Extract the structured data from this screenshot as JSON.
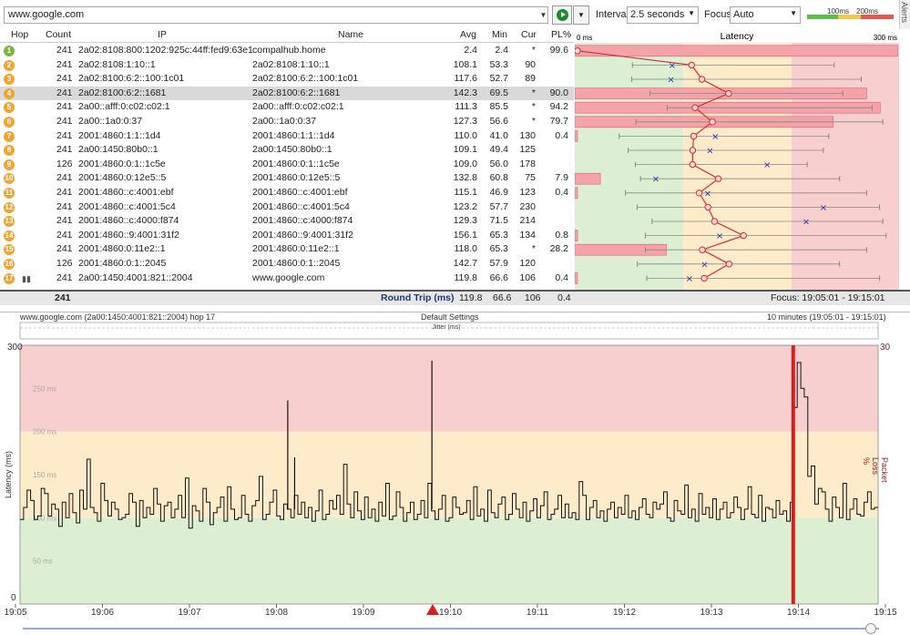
{
  "toolbar": {
    "url": "www.google.com",
    "interval_label": "Interval",
    "interval_value": "2.5 seconds",
    "focus_label": "Focus",
    "focus_value": "Auto",
    "legend_100": "100ms",
    "legend_200": "200ms"
  },
  "alerts_label": "Alerts",
  "table": {
    "headers": {
      "hop": "Hop",
      "count": "Count",
      "ip": "IP",
      "name": "Name",
      "avg": "Avg",
      "min": "Min",
      "cur": "Cur",
      "pl": "PL%",
      "latency": "Latency",
      "lat_min": "0 ms",
      "lat_max": "300 ms"
    },
    "rows": [
      {
        "hop": "1",
        "count": "241",
        "ip": "2a02:8108:800:1202:925c:44ff:fed9:63e1",
        "name": "compalhub.home",
        "avg": "2.4",
        "min": "2.4",
        "cur": "*",
        "pl": "99.6",
        "hopcolor": "#7cb342",
        "avgv": 2.4,
        "minv": 2.4,
        "curv": null,
        "maxv": null,
        "plv": 99.6
      },
      {
        "hop": "2",
        "count": "241",
        "ip": "2a02:8108:1:10::1",
        "name": "2a02:8108:1:10::1",
        "avg": "108.1",
        "min": "53.3",
        "cur": "90",
        "pl": "",
        "hopcolor": "#f0a530",
        "avgv": 108.1,
        "minv": 53.3,
        "curv": 90,
        "maxv": 240,
        "plv": 0
      },
      {
        "hop": "3",
        "count": "241",
        "ip": "2a02:8100:6:2::100:1c01",
        "name": "2a02:8100:6:2::100:1c01",
        "avg": "117.6",
        "min": "52.7",
        "cur": "89",
        "pl": "",
        "hopcolor": "#f0a530",
        "avgv": 117.6,
        "minv": 52.7,
        "curv": 89,
        "maxv": 265,
        "plv": 0
      },
      {
        "hop": "4",
        "count": "241",
        "ip": "2a02:8100:6:2::1681",
        "name": "2a02:8100:6:2::1681",
        "avg": "142.3",
        "min": "69.5",
        "cur": "*",
        "pl": "90.0",
        "hopcolor": "#f0a530",
        "avgv": 142.3,
        "minv": 69.5,
        "curv": null,
        "maxv": 248,
        "plv": 90.0
      },
      {
        "hop": "5",
        "count": "241",
        "ip": "2a00::afff:0:c02:c02:1",
        "name": "2a00::afff:0:c02:c02:1",
        "avg": "111.3",
        "min": "85.5",
        "cur": "*",
        "pl": "94.2",
        "hopcolor": "#f0a530",
        "avgv": 111.3,
        "minv": 85.5,
        "curv": null,
        "maxv": 275,
        "plv": 94.2
      },
      {
        "hop": "6",
        "count": "241",
        "ip": "2a00::1a0:0:37",
        "name": "2a00::1a0:0:37",
        "avg": "127.3",
        "min": "56.6",
        "cur": "*",
        "pl": "79.7",
        "hopcolor": "#f0a530",
        "avgv": 127.3,
        "minv": 56.6,
        "curv": null,
        "maxv": 285,
        "plv": 79.7
      },
      {
        "hop": "7",
        "count": "241",
        "ip": "2001:4860:1:1::1d4",
        "name": "2001:4860:1:1::1d4",
        "avg": "110.0",
        "min": "41.0",
        "cur": "130",
        "pl": "0.4",
        "hopcolor": "#f0a530",
        "avgv": 110.0,
        "minv": 41.0,
        "curv": 130,
        "maxv": 235,
        "plv": 0.4
      },
      {
        "hop": "8",
        "count": "241",
        "ip": "2a00:1450:80b0::1",
        "name": "2a00:1450:80b0::1",
        "avg": "109.1",
        "min": "49.4",
        "cur": "125",
        "pl": "",
        "hopcolor": "#f0a530",
        "avgv": 109.1,
        "minv": 49.4,
        "curv": 125,
        "maxv": 230,
        "plv": 0
      },
      {
        "hop": "9",
        "count": "126",
        "ip": "2001:4860:0:1::1c5e",
        "name": "2001:4860:0:1::1c5e",
        "avg": "109.0",
        "min": "56.0",
        "cur": "178",
        "pl": "",
        "hopcolor": "#f0a530",
        "avgv": 109.0,
        "minv": 56.0,
        "curv": 178,
        "maxv": 215,
        "plv": 0
      },
      {
        "hop": "10",
        "count": "241",
        "ip": "2001:4860:0:12e5::5",
        "name": "2001:4860:0:12e5::5",
        "avg": "132.8",
        "min": "60.8",
        "cur": "75",
        "pl": "7.9",
        "hopcolor": "#f0a530",
        "avgv": 132.8,
        "minv": 60.8,
        "curv": 75,
        "maxv": 245,
        "plv": 7.9
      },
      {
        "hop": "11",
        "count": "241",
        "ip": "2001:4860::c:4001:ebf",
        "name": "2001:4860::c:4001:ebf",
        "avg": "115.1",
        "min": "46.9",
        "cur": "123",
        "pl": "0.4",
        "hopcolor": "#f0a530",
        "avgv": 115.1,
        "minv": 46.9,
        "curv": 123,
        "maxv": 270,
        "plv": 0.4
      },
      {
        "hop": "12",
        "count": "241",
        "ip": "2001:4860::c:4001:5c4",
        "name": "2001:4860::c:4001:5c4",
        "avg": "123.2",
        "min": "57.7",
        "cur": "230",
        "pl": "",
        "hopcolor": "#f0a530",
        "avgv": 123.2,
        "minv": 57.7,
        "curv": 230,
        "maxv": 282,
        "plv": 0
      },
      {
        "hop": "13",
        "count": "241",
        "ip": "2001:4860::c:4000:f874",
        "name": "2001:4860::c:4000:f874",
        "avg": "129.3",
        "min": "71.5",
        "cur": "214",
        "pl": "",
        "hopcolor": "#f0a530",
        "avgv": 129.3,
        "minv": 71.5,
        "curv": 214,
        "maxv": 285,
        "plv": 0
      },
      {
        "hop": "14",
        "count": "241",
        "ip": "2001:4860::9:4001:31f2",
        "name": "2001:4860::9:4001:31f2",
        "avg": "156.1",
        "min": "65.3",
        "cur": "134",
        "pl": "0.8",
        "hopcolor": "#f0a530",
        "avgv": 156.1,
        "minv": 65.3,
        "curv": 134,
        "maxv": 288,
        "plv": 0.8
      },
      {
        "hop": "15",
        "count": "241",
        "ip": "2001:4860:0:11e2::1",
        "name": "2001:4860:0:11e2::1",
        "avg": "118.0",
        "min": "65.3",
        "cur": "*",
        "pl": "28.2",
        "hopcolor": "#f0a530",
        "avgv": 118.0,
        "minv": 65.3,
        "curv": null,
        "maxv": 270,
        "plv": 28.2
      },
      {
        "hop": "16",
        "count": "126",
        "ip": "2001:4860:0:1::2045",
        "name": "2001:4860:0:1::2045",
        "avg": "142.7",
        "min": "57.9",
        "cur": "120",
        "pl": "",
        "hopcolor": "#f0a530",
        "avgv": 142.7,
        "minv": 57.9,
        "curv": 120,
        "maxv": 245,
        "plv": 0
      },
      {
        "hop": "17",
        "count": "241",
        "ip": "2a00:1450:4001:821::2004",
        "name": "www.google.com",
        "avg": "119.8",
        "min": "66.6",
        "cur": "106",
        "pl": "0.4",
        "hopcolor": "#f0a530",
        "avgv": 119.8,
        "minv": 66.6,
        "curv": 106,
        "maxv": 282,
        "plv": 0.4
      }
    ],
    "footer": {
      "count": "241",
      "label": "Round Trip (ms)",
      "avg": "119.8",
      "min": "66.6",
      "cur": "106",
      "pl": "0.4",
      "focus": "Focus: 19:05:01 - 19:15:01"
    }
  },
  "graph": {
    "title_left": "www.google.com (2a00:1450:4001:821::2004) hop 17",
    "title_center": "Default Settings",
    "title_right": "10 minutes (19:05:01 - 19:15:01)",
    "jitter_label": "Jitter (ms)",
    "ylabel": "Latency (ms)",
    "y2label": "Packet Loss %",
    "y_top": "300",
    "y_bottom": "0",
    "y2_top": "30",
    "grid_labels": [
      "250 ms",
      "200 ms",
      "150 ms",
      "100 ms",
      "50 ms"
    ],
    "x_labels": [
      "19:05",
      "19:06",
      "19:07",
      "19:08",
      "19:09",
      "19:10",
      "19:11",
      "19:12",
      "19:13",
      "19:14",
      "19:15"
    ],
    "colors": {
      "red": "#f7cfcf",
      "yellow": "#fdebc9",
      "green": "#dcefd3"
    }
  },
  "chart_data": {
    "type": "line",
    "title": "www.google.com (2a00:1450:4001:821::2004) hop 17",
    "xlabel": "",
    "ylabel": "Latency (ms)",
    "ylim": [
      0,
      300
    ],
    "x_range": [
      "19:05",
      "19:15"
    ],
    "series": [
      {
        "name": "Latency (ms)",
        "values": [
          98,
          112,
          132,
          120,
          98,
          102,
          134,
          128,
          102,
          116,
          110,
          90,
          118,
          100,
          128,
          106,
          94,
          132,
          110,
          168,
          112,
          106,
          96,
          140,
          120,
          102,
          118,
          110,
          98,
          100,
          104,
          128,
          118,
          90,
          120,
          100,
          112,
          104,
          134,
          116,
          96,
          114,
          118,
          100,
          110,
          126,
          100,
          146,
          88,
          114,
          108,
          96,
          134,
          118,
          92,
          106,
          112,
          124,
          96,
          136,
          110,
          98,
          100,
          126,
          104,
          96,
          114,
          120,
          148,
          98,
          104,
          118,
          132,
          102,
          98,
          116,
          110,
          100,
          126,
          104,
          118,
          100,
          112,
          96,
          108,
          132,
          98,
          104,
          120,
          110,
          126,
          104,
          162,
          116,
          100,
          130,
          108,
          98,
          124,
          100,
          110,
          96,
          118,
          102,
          140,
          98,
          102,
          130,
          112,
          96,
          106,
          118,
          98,
          104,
          120,
          100,
          140,
          108,
          98,
          110,
          126,
          96,
          100,
          124,
          112,
          104,
          106,
          120,
          98,
          136,
          102,
          110,
          96,
          132,
          106,
          100,
          116,
          124,
          98,
          104,
          128,
          110,
          100,
          118,
          96,
          108,
          122,
          100,
          114,
          130,
          98,
          104,
          110,
          126,
          100,
          116,
          100,
          106,
          98,
          142,
          126,
          98,
          112,
          120,
          100,
          108,
          96,
          110,
          118,
          100,
          112,
          104,
          126,
          100,
          108,
          98,
          112,
          122,
          104,
          100,
          118,
          110,
          116,
          130,
          100,
          96,
          120,
          108,
          104,
          138,
          100,
          110,
          96,
          128,
          104,
          112,
          100,
          122,
          98,
          110,
          118,
          100,
          106,
          124,
          112,
          98,
          110,
          136,
          104,
          100,
          126,
          96,
          112,
          110,
          100,
          120,
          104,
          108,
          96,
          118,
          228,
          280,
          250,
          240,
          148,
          160,
          116,
          134,
          130,
          110,
          96,
          124,
          112,
          100,
          140,
          98,
          110,
          122,
          104,
          102,
          118,
          130,
          110,
          112
        ]
      }
    ],
    "spike_values": [
      {
        "x_fraction": 0.32,
        "value": 170
      },
      {
        "x_fraction": 0.48,
        "value": 282
      },
      {
        "x_fraction": 0.312,
        "value": 236
      }
    ],
    "packet_loss": [
      {
        "time": "19:14:30",
        "value": 30
      }
    ]
  }
}
